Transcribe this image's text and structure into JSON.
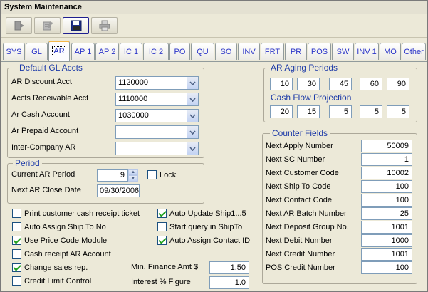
{
  "window": {
    "title": "System Maintenance"
  },
  "toolbar": {
    "buttons": [
      {
        "name": "exit",
        "icon": "exit-door-icon"
      },
      {
        "name": "edit",
        "icon": "edit-icon"
      },
      {
        "name": "save",
        "icon": "save-disk-icon"
      },
      {
        "name": "print",
        "icon": "printer-icon"
      }
    ]
  },
  "tabs": [
    "SYS",
    "GL",
    "AR",
    "AP 1",
    "AP 2",
    "IC 1",
    "IC 2",
    "PO",
    "QU",
    "SO",
    "INV",
    "FRT",
    "PR",
    "POS",
    "SW",
    "INV 1",
    "MO",
    "Other"
  ],
  "selected_tab": "AR",
  "default_gl": {
    "legend": "Default GL Accts",
    "rows": [
      {
        "label": "AR Discount Acct",
        "value": "1120000"
      },
      {
        "label": "Accts Receivable  Acct",
        "value": "1110000"
      },
      {
        "label": "Ar Cash Account",
        "value": "1030000"
      },
      {
        "label": "Ar Prepaid Account",
        "value": ""
      },
      {
        "label": "Inter-Company AR",
        "value": ""
      }
    ]
  },
  "period": {
    "legend": "Period",
    "current_label": "Current AR Period",
    "current_value": "9",
    "lock_label": "Lock",
    "lock_checked": false,
    "close_label": "Next AR Close Date",
    "close_value": "09/30/2006"
  },
  "options_left": [
    {
      "label": "Print customer cash receipt ticket",
      "checked": false
    },
    {
      "label": "Auto Assign Ship To No",
      "checked": false
    },
    {
      "label": "Use Price Code Module",
      "checked": true
    },
    {
      "label": "Cash receipt AR Account",
      "checked": false
    },
    {
      "label": "Change sales rep.",
      "checked": true
    },
    {
      "label": "Credit Limit Control",
      "checked": false
    }
  ],
  "options_right": [
    {
      "label": "Auto Update Ship1...5",
      "checked": true
    },
    {
      "label": "Start query in ShipTo",
      "checked": false
    },
    {
      "label": "Auto Assign Contact ID",
      "checked": true
    }
  ],
  "finance": {
    "min_label": "Min. Finance Amt $",
    "min_value": "1.50",
    "interest_label": "Interest % Figure",
    "interest_value": "1.0"
  },
  "aging": {
    "legend": "AR Aging Periods",
    "values": [
      "10",
      "30",
      "45",
      "60",
      "90"
    ],
    "cash_flow_label": "Cash Flow Projection",
    "cash_flow_values": [
      "20",
      "15",
      "5",
      "5",
      "5"
    ]
  },
  "counters": {
    "legend": "Counter Fields",
    "rows": [
      {
        "label": "Next Apply  Number",
        "value": "50009"
      },
      {
        "label": "Next SC Number",
        "value": "1"
      },
      {
        "label": "Next Customer Code",
        "value": "10002"
      },
      {
        "label": "Next Ship To Code",
        "value": "100"
      },
      {
        "label": "Next Contact Code",
        "value": "100"
      },
      {
        "label": "Next AR Batch Number",
        "value": "25"
      },
      {
        "label": "Next Deposit Group No.",
        "value": "1001"
      },
      {
        "label": "Next Debit Number",
        "value": "1000"
      },
      {
        "label": "Next Credit Number",
        "value": "1001"
      },
      {
        "label": "POS Credit Number",
        "value": "100"
      }
    ]
  }
}
